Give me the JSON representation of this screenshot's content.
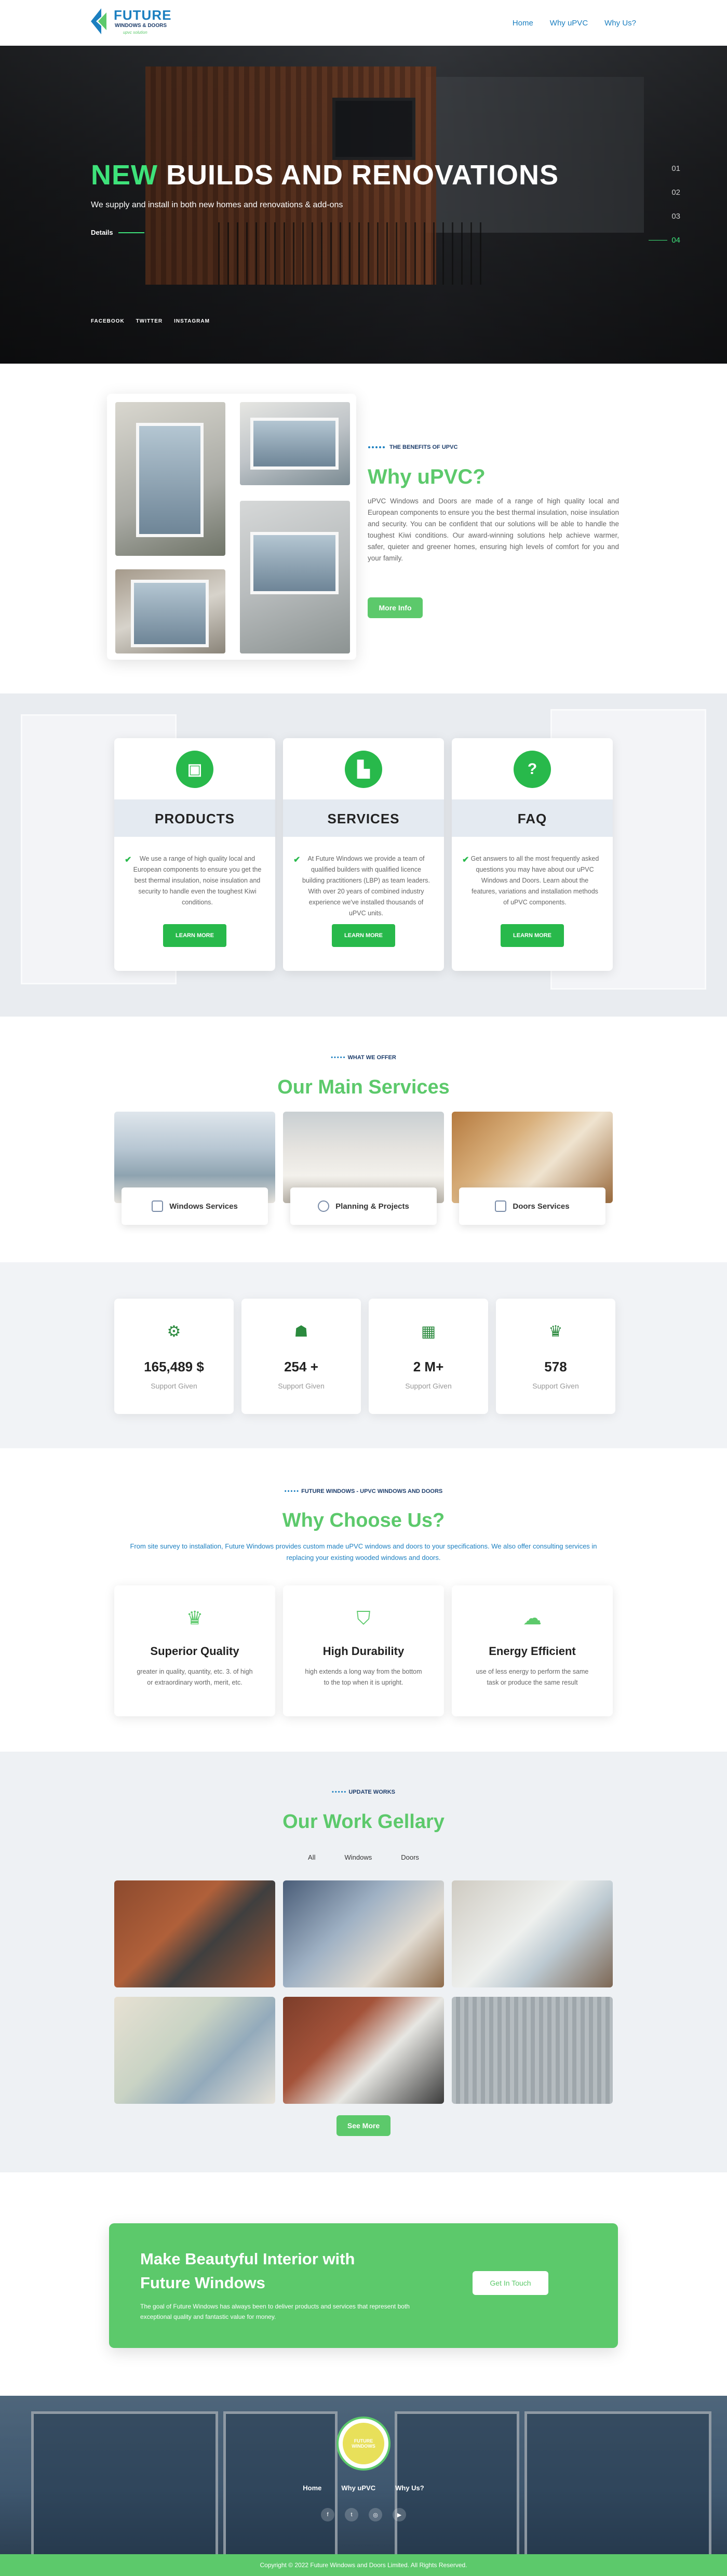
{
  "header": {
    "logo_title": "FUTURE",
    "logo_sub": "WINDOWS & DOORS",
    "logo_tag": "upvc solution",
    "nav": [
      "Home",
      "Why uPVC",
      "Why Us?"
    ]
  },
  "hero": {
    "title_highlight": "NEW",
    "title_rest": " BUILDS AND RENOVATIONS",
    "subtitle": "We supply and install in both new homes and renovations & add-ons",
    "details": "Details",
    "social": [
      "FACEBOOK",
      "TWITTER",
      "INSTAGRAM"
    ],
    "pager": [
      "01",
      "02",
      "03",
      "04"
    ],
    "active_page": "04"
  },
  "why": {
    "kicker": "THE BENEFITS OF UPVC",
    "title": "Why uPVC?",
    "text": "uPVC Windows and Doors are made of a range of high quality local and European components to ensure you the best thermal insulation, noise insulation and security. You can be confident that our solutions will be able to handle the toughest Kiwi conditions. Our award-winning solutions help achieve warmer, safer, quieter and greener homes, ensuring high levels of comfort for you and your family.",
    "button": "More Info"
  },
  "cards": [
    {
      "icon": "box-icon",
      "title": "PRODUCTS",
      "text": "We use a range of high quality local and European components to ensure you get the best thermal insulation, noise insulation and security to handle even the toughest Kiwi conditions.",
      "button": "LEARN MORE"
    },
    {
      "icon": "building-icon",
      "title": "SERVICES",
      "text": "At Future Windows we provide a team of qualified builders with qualified licence building practitioners (LBP) as team leaders. With over 20 years of combined industry experience we've installed thousands of uPVC units.",
      "button": "LEARN MORE"
    },
    {
      "icon": "question-icon",
      "title": "FAQ",
      "text": "Get answers to all the most frequently asked questions you may have about our uPVC Windows and Doors. Learn about the features, variations and installation methods of uPVC components.",
      "button": "LEARN MORE"
    }
  ],
  "main_services": {
    "kicker": "WHAT WE OFFER",
    "title": "Our Main Services",
    "items": [
      {
        "label": "Windows Services",
        "icon": "window-icon"
      },
      {
        "label": "Planning & Projects",
        "icon": "planning-icon"
      },
      {
        "label": "Doors Services",
        "icon": "door-icon"
      }
    ]
  },
  "stats": [
    {
      "icon": "support-icon",
      "value": "165,489 $",
      "label": "Support Given"
    },
    {
      "icon": "team-icon",
      "value": "254 +",
      "label": "Support Given"
    },
    {
      "icon": "calendar-icon",
      "value": "2 M+",
      "label": "Support Given"
    },
    {
      "icon": "trophy-icon",
      "value": "578",
      "label": "Support Given"
    }
  ],
  "why_choose": {
    "kicker": "FUTURE WINDOWS - UPVC WINDOWS AND DOORS",
    "title": "Why Choose Us?",
    "desc": "From site survey to installation, Future Windows provides custom made uPVC windows and doors to your specifications. We also offer consulting services in replacing your existing wooded windows and doors.",
    "features": [
      {
        "icon": "trophy-icon",
        "title": "Superior Quality",
        "text": "greater in quality, quantity, etc. 3. of high or extraordinary worth, merit, etc."
      },
      {
        "icon": "shield-icon",
        "title": "High Durability",
        "text": "high extends a long way from the bottom to the top when it is upright."
      },
      {
        "icon": "cloud-icon",
        "title": "Energy Efficient",
        "text": "use of less energy to perform the same task or produce the same result"
      }
    ]
  },
  "gallery": {
    "kicker": "UPDATE WORKS",
    "title": "Our Work Gellary",
    "tabs": [
      "All",
      "Windows",
      "Doors"
    ],
    "button": "See More"
  },
  "cta": {
    "title": "Make Beautyful Interior with Future Windows",
    "text": "The goal of Future Windows has always been to deliver products and services that represent both exceptional quality and fantastic value for money.",
    "button": "Get In Touch"
  },
  "footer": {
    "logo_text": "FUTURE WINDOWS",
    "nav": [
      "Home",
      "Why uPVC",
      "Why Us?"
    ],
    "social_icons": [
      "facebook-icon",
      "twitter-icon",
      "instagram-icon",
      "youtube-icon"
    ],
    "copyright": "Copyright © 2022 Future Windows and Doors Limited. All Rights Reserved."
  },
  "colors": {
    "accent": "#5cc96b",
    "brand_blue": "#1b7fc0",
    "navy": "#1d3d6b"
  }
}
